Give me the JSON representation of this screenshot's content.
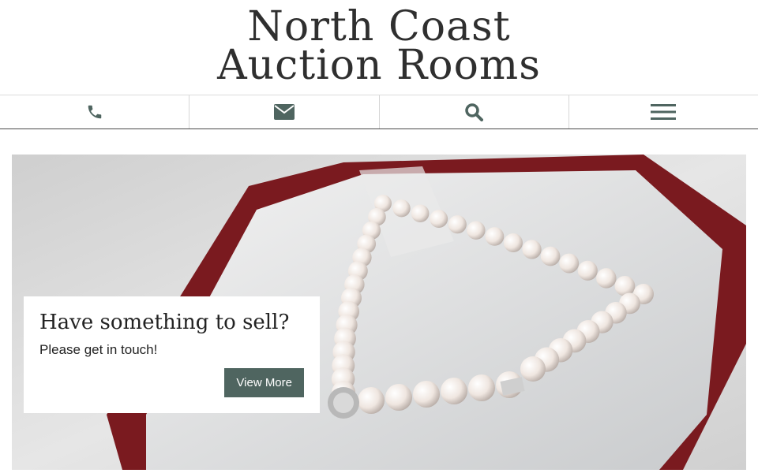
{
  "site": {
    "name_line1": "North Coast",
    "name_line2": "Auction Rooms"
  },
  "nav": {
    "items": [
      {
        "icon": "phone-icon"
      },
      {
        "icon": "envelope-icon"
      },
      {
        "icon": "search-icon"
      },
      {
        "icon": "menu-icon"
      }
    ],
    "icon_color": "#4f6560"
  },
  "hero": {
    "image_subject": "pearl necklace in red box",
    "heading": "Have something to sell?",
    "text": "Please get in touch!",
    "button_label": "View More",
    "button_color": "#4f6560"
  }
}
